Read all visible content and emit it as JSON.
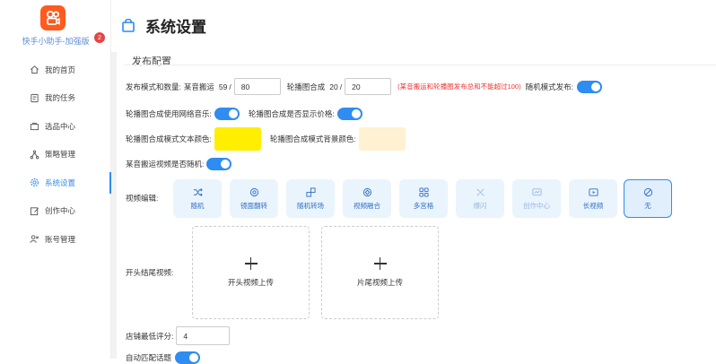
{
  "brand": {
    "name": "快手小助手-加强版"
  },
  "sidebar": {
    "items": [
      {
        "label": "我的首页",
        "icon": "home-icon"
      },
      {
        "label": "我的任务",
        "icon": "task-icon",
        "badge": "2"
      },
      {
        "label": "选品中心",
        "icon": "product-icon"
      },
      {
        "label": "策略管理",
        "icon": "strategy-icon"
      },
      {
        "label": "系统设置",
        "icon": "settings-icon",
        "active": true
      },
      {
        "label": "创作中心",
        "icon": "edit-icon"
      },
      {
        "label": "账号管理",
        "icon": "account-icon"
      }
    ]
  },
  "header": {
    "title": "系统设置"
  },
  "form": {
    "section_title": "发布配置",
    "publish_mode_label": "发布模式和数量:",
    "move_label": "某音搬运",
    "move_count": "59",
    "move_sep": "/",
    "move_total": "80",
    "carousel_label": "轮播图合成",
    "carousel_count": "20",
    "carousel_sep": "/",
    "carousel_total": "20",
    "warning": "(某音搬运和轮播图发布总和不能超过100)",
    "random_mode_label": "随机模式发布:",
    "carousel_music_label": "轮播图合成使用网络音乐:",
    "carousel_price_label": "轮播图合成是否显示价格:",
    "text_color_label": "轮播图合成模式文本颜色:",
    "bg_color_label": "轮播图合成模式背景颜色:",
    "text_color": "#ffee00",
    "bg_color": "#fff1d2",
    "random_video_label": "某音搬运视频是否随机:",
    "video_edit_label": "视频编辑:",
    "video_effects": [
      {
        "label": "随机",
        "icon": "shuffle-icon"
      },
      {
        "label": "镜面翻转",
        "icon": "mirror-flip-icon"
      },
      {
        "label": "随机转场",
        "icon": "transition-icon"
      },
      {
        "label": "视频融合",
        "icon": "video-merge-icon"
      },
      {
        "label": "多宫格",
        "icon": "grid-icon"
      },
      {
        "label": "爆闪",
        "icon": "flash-icon",
        "dim": true
      },
      {
        "label": "创作中心",
        "icon": "creator-icon",
        "dim": true
      },
      {
        "label": "长视频",
        "icon": "long-video-icon"
      },
      {
        "label": "无",
        "icon": "none-icon",
        "selected": true
      }
    ],
    "intro_outro_label": "开头结尾视频:",
    "intro_upload": "开头视频上传",
    "outro_upload": "片尾视频上传",
    "min_score_label": "店铺最低评分:",
    "min_score": "4",
    "auto_match_label": "自动匹配话题"
  },
  "colors": {
    "accent": "#2f8cf0",
    "logo": "#ff5a1f",
    "warning": "#e33333"
  }
}
